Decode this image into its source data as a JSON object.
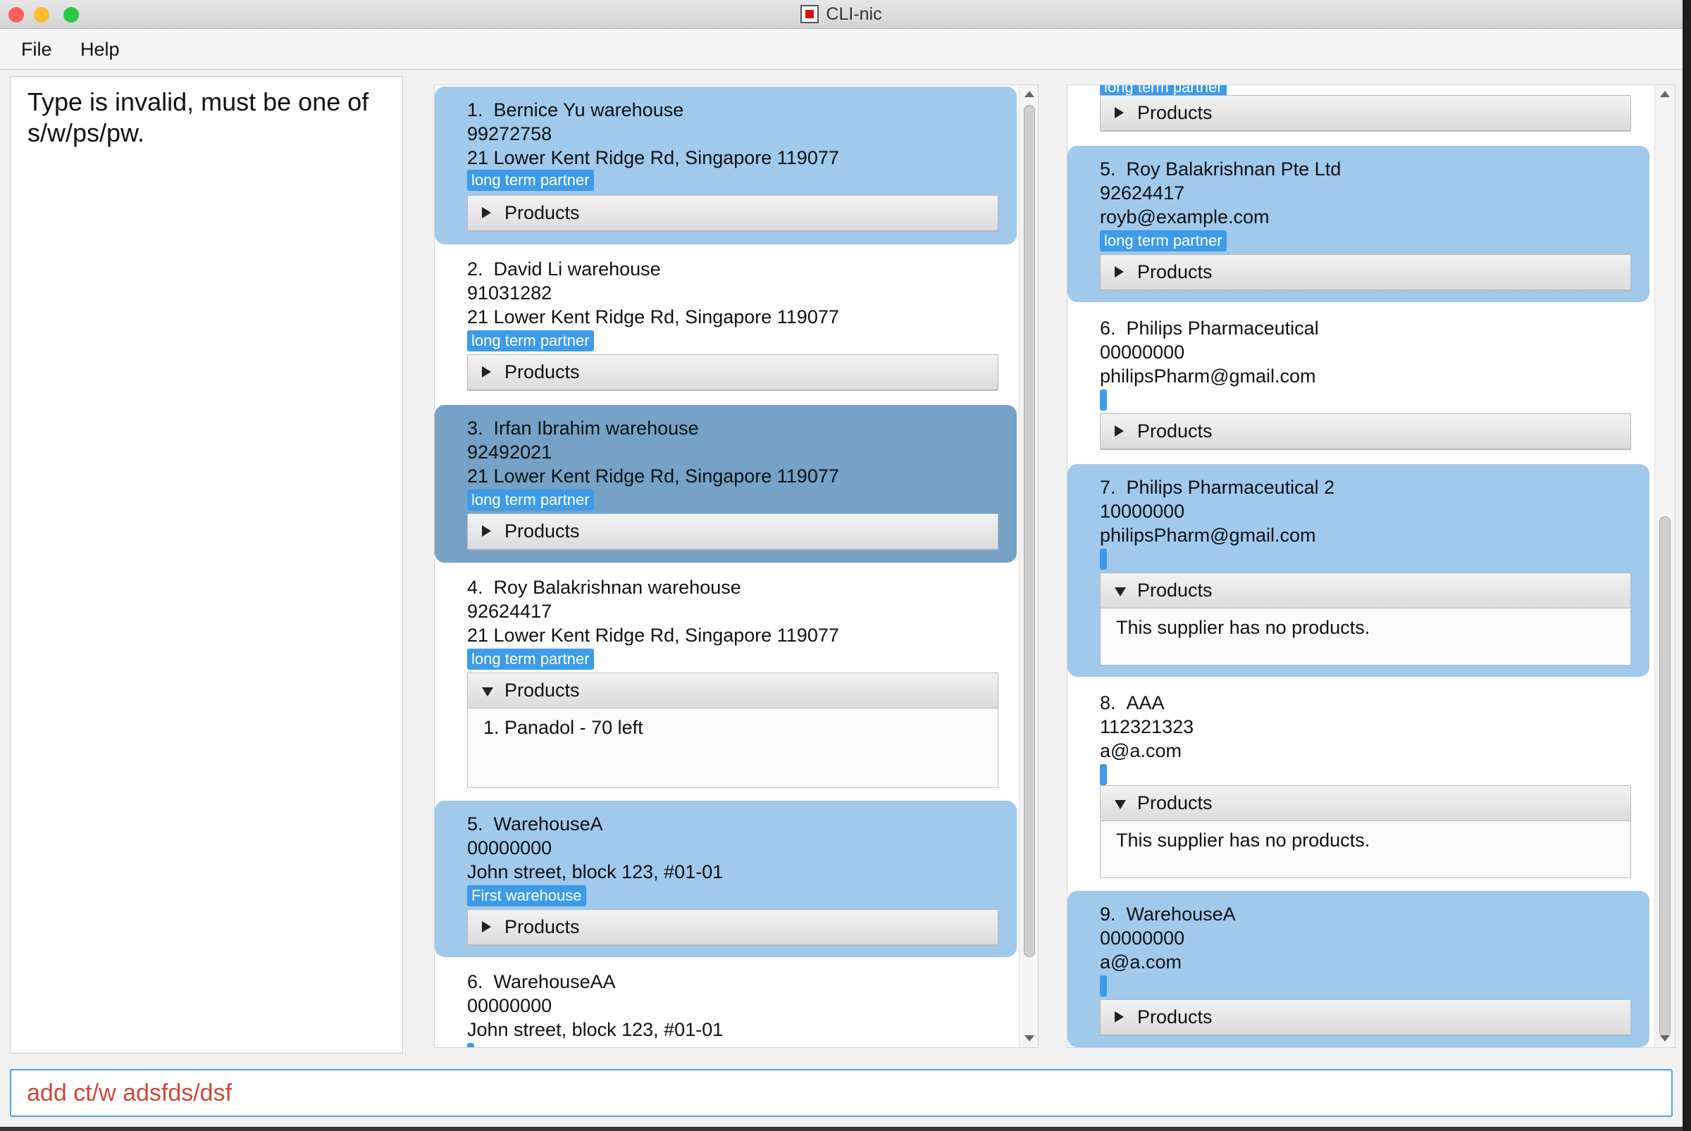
{
  "window": {
    "title": "CLI-nic"
  },
  "menu": {
    "file": "File",
    "help": "Help"
  },
  "result": {
    "message": "Type is invalid, must be one of s/w/ps/pw."
  },
  "command": {
    "value": "add ct/w adsfds/dsf"
  },
  "products_label": "Products",
  "warehouses": [
    {
      "index": "1.",
      "name": "Bernice Yu warehouse",
      "phone": "99272758",
      "address": "21 Lower Kent Ridge Rd, Singapore 119077",
      "tag": "long term partner",
      "expanded": false,
      "product_text": ""
    },
    {
      "index": "2.",
      "name": "David Li warehouse",
      "phone": "91031282",
      "address": "21 Lower Kent Ridge Rd, Singapore 119077",
      "tag": "long term partner",
      "expanded": false,
      "product_text": ""
    },
    {
      "index": "3.",
      "name": "Irfan Ibrahim warehouse",
      "phone": "92492021",
      "address": "21 Lower Kent Ridge Rd, Singapore 119077",
      "tag": "long term partner",
      "expanded": false,
      "product_text": ""
    },
    {
      "index": "4.",
      "name": "Roy Balakrishnan warehouse",
      "phone": "92624417",
      "address": "21 Lower Kent Ridge Rd, Singapore 119077",
      "tag": "long term partner",
      "expanded": true,
      "product_text": "1. Panadol - 70 left"
    },
    {
      "index": "5.",
      "name": "WarehouseA",
      "phone": "00000000",
      "address": "John street, block 123, #01-01",
      "tag": "First warehouse",
      "expanded": false,
      "product_text": ""
    },
    {
      "index": "6.",
      "name": "WarehouseAA",
      "phone": "00000000",
      "address": "John street, block 123, #01-01",
      "tag": "",
      "expanded": false,
      "product_text": ""
    }
  ],
  "suppliers": [
    {
      "index": "",
      "name": "",
      "phone": "",
      "address": "",
      "tag": "long term partner",
      "expanded": false,
      "product_text": ""
    },
    {
      "index": "5.",
      "name": "Roy Balakrishnan Pte Ltd",
      "phone": "92624417",
      "address": "royb@example.com",
      "tag": "long term partner",
      "expanded": false,
      "product_text": ""
    },
    {
      "index": "6.",
      "name": "Philips Pharmaceutical",
      "phone": "00000000",
      "address": "philipsPharm@gmail.com",
      "tag": "",
      "expanded": false,
      "product_text": ""
    },
    {
      "index": "7.",
      "name": "Philips Pharmaceutical 2",
      "phone": "10000000",
      "address": "philipsPharm@gmail.com",
      "tag": "",
      "expanded": true,
      "product_text": "This supplier has no products."
    },
    {
      "index": "8.",
      "name": "AAA",
      "phone": "112321323",
      "address": "a@a.com",
      "tag": "",
      "expanded": true,
      "product_text": "This supplier has no products."
    },
    {
      "index": "9.",
      "name": "WarehouseA",
      "phone": "00000000",
      "address": "a@a.com",
      "tag": "",
      "expanded": false,
      "product_text": ""
    }
  ],
  "colors": {
    "highlight": "#a0c9ec",
    "selected": "#75a2c6",
    "tag": "#3d9be9",
    "command_text": "#d0463a",
    "command_border": "#4aa3e8"
  }
}
